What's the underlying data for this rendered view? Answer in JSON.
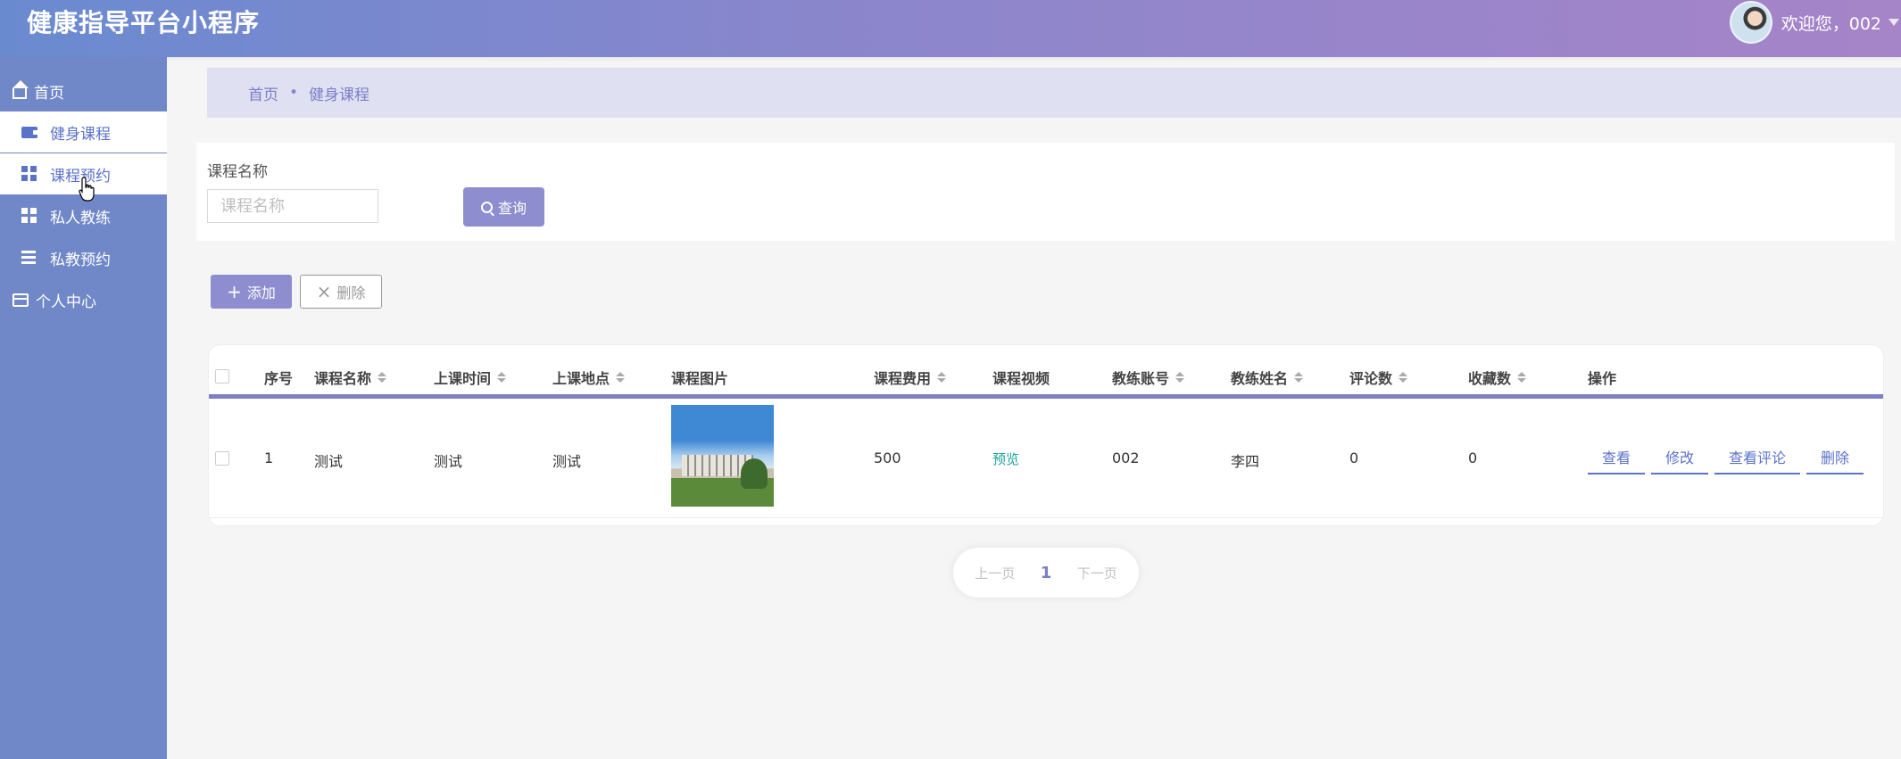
{
  "header": {
    "app_title": "健康指导平台小程序",
    "welcome": "欢迎您，002"
  },
  "sidebar": {
    "items": [
      {
        "label": "首页",
        "icon": "home-icon",
        "level": "top"
      },
      {
        "label": "健身课程",
        "icon": "wallet-icon",
        "level": "sub"
      },
      {
        "label": "课程预约",
        "icon": "grid-icon",
        "level": "sub",
        "active": true
      },
      {
        "label": "私人教练",
        "icon": "grid-icon",
        "level": "sub"
      },
      {
        "label": "私教预约",
        "icon": "list-icon",
        "level": "sub"
      },
      {
        "label": "个人中心",
        "icon": "card-icon",
        "level": "top"
      }
    ]
  },
  "breadcrumb": {
    "home": "首页",
    "separator": "•",
    "current": "健身课程"
  },
  "search": {
    "label": "课程名称",
    "placeholder": "课程名称",
    "button": "查询"
  },
  "actions": {
    "add": "添加",
    "delete": "删除"
  },
  "table": {
    "columns": [
      "序号",
      "课程名称",
      "上课时间",
      "上课地点",
      "课程图片",
      "课程费用",
      "课程视频",
      "教练账号",
      "教练姓名",
      "评论数",
      "收藏数",
      "操作"
    ],
    "rows": [
      {
        "index": "1",
        "course_name": "测试",
        "time": "测试",
        "location": "测试",
        "image": "campus-building-photo",
        "fee": "500",
        "video": "预览",
        "coach_account": "002",
        "coach_name": "李四",
        "comments": "0",
        "favorites": "0",
        "operations": [
          "查看",
          "修改",
          "查看评论",
          "删除"
        ]
      }
    ]
  },
  "pagination": {
    "prev": "上一页",
    "current": "1",
    "next": "下一页"
  },
  "colors": {
    "accent": "#8d8dcf",
    "sidebar": "#7088c8",
    "link": "#5a72c8",
    "preview": "#1aa39a"
  }
}
